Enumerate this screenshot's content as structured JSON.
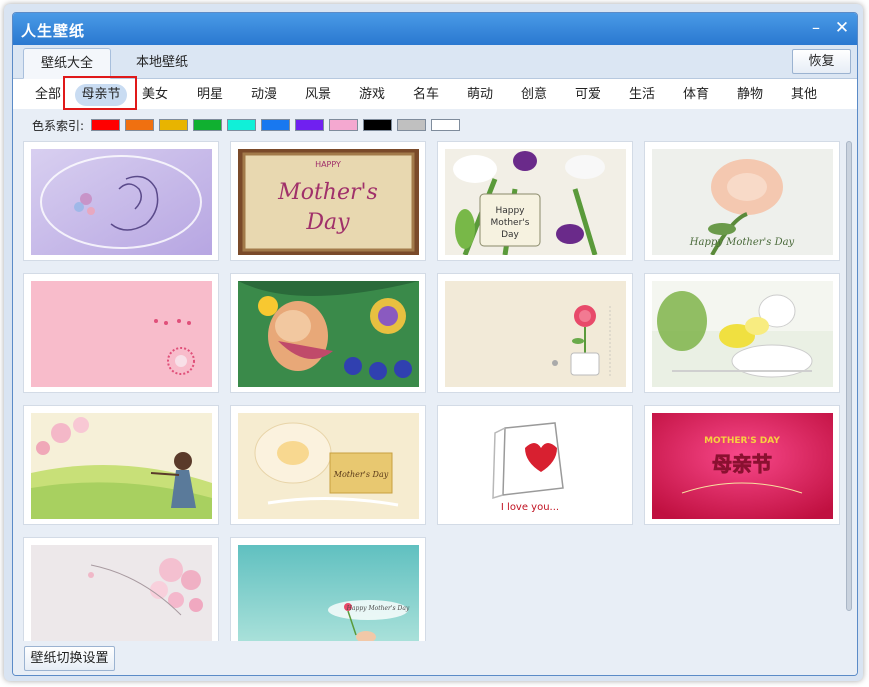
{
  "window": {
    "title": "人生壁纸",
    "minimize_glyph": "–",
    "close_glyph": "✕"
  },
  "tabs": [
    {
      "label": "壁纸大全",
      "active": true
    },
    {
      "label": "本地壁纸",
      "active": false
    }
  ],
  "restore_label": "恢复",
  "categories": [
    {
      "label": "全部",
      "active": false
    },
    {
      "label": "母亲节",
      "active": true
    },
    {
      "label": "美女",
      "active": false
    },
    {
      "label": "明星",
      "active": false
    },
    {
      "label": "动漫",
      "active": false
    },
    {
      "label": "风景",
      "active": false
    },
    {
      "label": "游戏",
      "active": false
    },
    {
      "label": "名车",
      "active": false
    },
    {
      "label": "萌动",
      "active": false
    },
    {
      "label": "创意",
      "active": false
    },
    {
      "label": "可爱",
      "active": false
    },
    {
      "label": "生活",
      "active": false
    },
    {
      "label": "体育",
      "active": false
    },
    {
      "label": "静物",
      "active": false
    },
    {
      "label": "其他",
      "active": false
    }
  ],
  "color_index": {
    "label": "色系索引:",
    "swatches": [
      "#ff0000",
      "#f07010",
      "#e8b400",
      "#10b030",
      "#10f0d8",
      "#1878f0",
      "#7020f0",
      "#f4a8d0",
      "#000000",
      "#c0c0c0",
      "#ffffff"
    ]
  },
  "wallpapers": [
    {
      "name": "mother-embrace-purple",
      "caption": ""
    },
    {
      "name": "happy-mothers-day-parchment",
      "caption": "HAPPY Mother's Day"
    },
    {
      "name": "tulips-tag",
      "caption": "Happy Mother's Day"
    },
    {
      "name": "peach-rose",
      "caption": "Happy Mother's Day"
    },
    {
      "name": "pink-heart-minimal",
      "caption": ""
    },
    {
      "name": "cartoon-mother-baby",
      "caption": ""
    },
    {
      "name": "carnation-vase",
      "caption": ""
    },
    {
      "name": "white-yellow-flowers",
      "caption": ""
    },
    {
      "name": "girl-spring-field",
      "caption": ""
    },
    {
      "name": "ribbon-card",
      "caption": "Mother's Day"
    },
    {
      "name": "i-love-you-heart-box",
      "caption": "I love you..."
    },
    {
      "name": "mothers-day-red",
      "caption": "MOTHER'S DAY 母亲节"
    },
    {
      "name": "pink-blossoms",
      "caption": ""
    },
    {
      "name": "teal-hand-flower",
      "caption": "Happy Mother's Day"
    }
  ],
  "settings_label": "壁纸切换设置"
}
